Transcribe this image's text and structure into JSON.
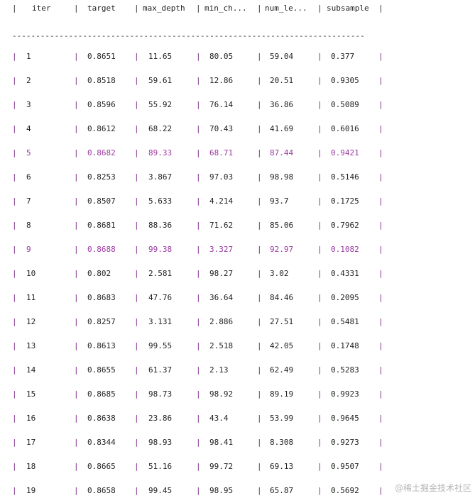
{
  "header": {
    "columns": [
      "iter",
      "target",
      "max_depth",
      "min_ch...",
      "num_le...",
      "subsample"
    ]
  },
  "divider": "---------------------------------------------------------------------------",
  "rows": [
    {
      "iter": "1",
      "target": "0.8651",
      "max_depth": "11.65",
      "min_ch": "80.05",
      "num_le": "59.04",
      "subsample": "0.377",
      "highlight": false
    },
    {
      "iter": "2",
      "target": "0.8518",
      "max_depth": "59.61",
      "min_ch": "12.86",
      "num_le": "20.51",
      "subsample": "0.9305",
      "highlight": false
    },
    {
      "iter": "3",
      "target": "0.8596",
      "max_depth": "55.92",
      "min_ch": "76.14",
      "num_le": "36.86",
      "subsample": "0.5089",
      "highlight": false
    },
    {
      "iter": "4",
      "target": "0.8612",
      "max_depth": "68.22",
      "min_ch": "70.43",
      "num_le": "41.69",
      "subsample": "0.6016",
      "highlight": false
    },
    {
      "iter": "5",
      "target": "0.8682",
      "max_depth": "89.33",
      "min_ch": "68.71",
      "num_le": "87.44",
      "subsample": "0.9421",
      "highlight": true
    },
    {
      "iter": "6",
      "target": "0.8253",
      "max_depth": "3.867",
      "min_ch": "97.03",
      "num_le": "98.98",
      "subsample": "0.5146",
      "highlight": false
    },
    {
      "iter": "7",
      "target": "0.8507",
      "max_depth": "5.633",
      "min_ch": "4.214",
      "num_le": "93.7",
      "subsample": "0.1725",
      "highlight": false
    },
    {
      "iter": "8",
      "target": "0.8681",
      "max_depth": "88.36",
      "min_ch": "71.62",
      "num_le": "85.06",
      "subsample": "0.7962",
      "highlight": false
    },
    {
      "iter": "9",
      "target": "0.8688",
      "max_depth": "99.38",
      "min_ch": "3.327",
      "num_le": "92.97",
      "subsample": "0.1082",
      "highlight": true
    },
    {
      "iter": "10",
      "target": "0.802",
      "max_depth": "2.581",
      "min_ch": "98.27",
      "num_le": "3.02",
      "subsample": "0.4331",
      "highlight": false
    },
    {
      "iter": "11",
      "target": "0.8683",
      "max_depth": "47.76",
      "min_ch": "36.64",
      "num_le": "84.46",
      "subsample": "0.2095",
      "highlight": false
    },
    {
      "iter": "12",
      "target": "0.8257",
      "max_depth": "3.131",
      "min_ch": "2.886",
      "num_le": "27.51",
      "subsample": "0.5481",
      "highlight": false
    },
    {
      "iter": "13",
      "target": "0.8613",
      "max_depth": "99.55",
      "min_ch": "2.518",
      "num_le": "42.05",
      "subsample": "0.1748",
      "highlight": false
    },
    {
      "iter": "14",
      "target": "0.8655",
      "max_depth": "61.37",
      "min_ch": "2.13",
      "num_le": "62.49",
      "subsample": "0.5283",
      "highlight": false
    },
    {
      "iter": "15",
      "target": "0.8685",
      "max_depth": "98.73",
      "min_ch": "98.92",
      "num_le": "89.19",
      "subsample": "0.9923",
      "highlight": false
    },
    {
      "iter": "16",
      "target": "0.8638",
      "max_depth": "23.86",
      "min_ch": "43.4",
      "num_le": "53.99",
      "subsample": "0.9645",
      "highlight": false
    },
    {
      "iter": "17",
      "target": "0.8344",
      "max_depth": "98.93",
      "min_ch": "98.41",
      "num_le": "8.308",
      "subsample": "0.9273",
      "highlight": false
    },
    {
      "iter": "18",
      "target": "0.8665",
      "max_depth": "51.16",
      "min_ch": "99.72",
      "num_le": "69.13",
      "subsample": "0.9507",
      "highlight": false
    },
    {
      "iter": "19",
      "target": "0.8658",
      "max_depth": "99.45",
      "min_ch": "98.95",
      "num_le": "65.87",
      "subsample": "0.5692",
      "highlight": false
    }
  ],
  "watermark": "@稀土掘金技术社区",
  "colors": {
    "highlight_text": "#9b3aa1",
    "separator": "#7d2a88"
  }
}
